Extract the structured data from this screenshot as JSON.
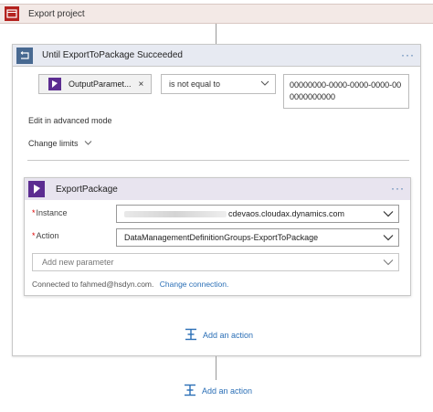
{
  "top_action": {
    "title": "Export project",
    "icon": "project-icon"
  },
  "until": {
    "title": "Until ExportToPackage Succeeded",
    "icon": "loop-icon",
    "condition": {
      "token_label": "OutputParamet...",
      "token_icon": "dynamics-icon",
      "operator": "is not equal to",
      "value": "00000000-0000-0000-0000-000000000000"
    },
    "edit_advanced": "Edit in advanced mode",
    "change_limits": "Change limits"
  },
  "inner_action": {
    "title": "ExportPackage",
    "icon": "dynamics-icon",
    "instance_label": "Instance",
    "instance_value": "cdevaos.cloudax.dynamics.com",
    "action_label": "Action",
    "action_value": "DataManagementDefinitionGroups-ExportToPackage",
    "add_param_placeholder": "Add new parameter",
    "connected_text": "Connected to fahmed@hsdyn.com.",
    "change_connection": "Change connection."
  },
  "add_action_inner": "Add an action",
  "add_action_outer": "Add an action",
  "colors": {
    "project_icon": "#b4231f",
    "loop_icon": "#486991",
    "dynamics_icon": "#5c2d91",
    "link": "#2b6fb6"
  }
}
